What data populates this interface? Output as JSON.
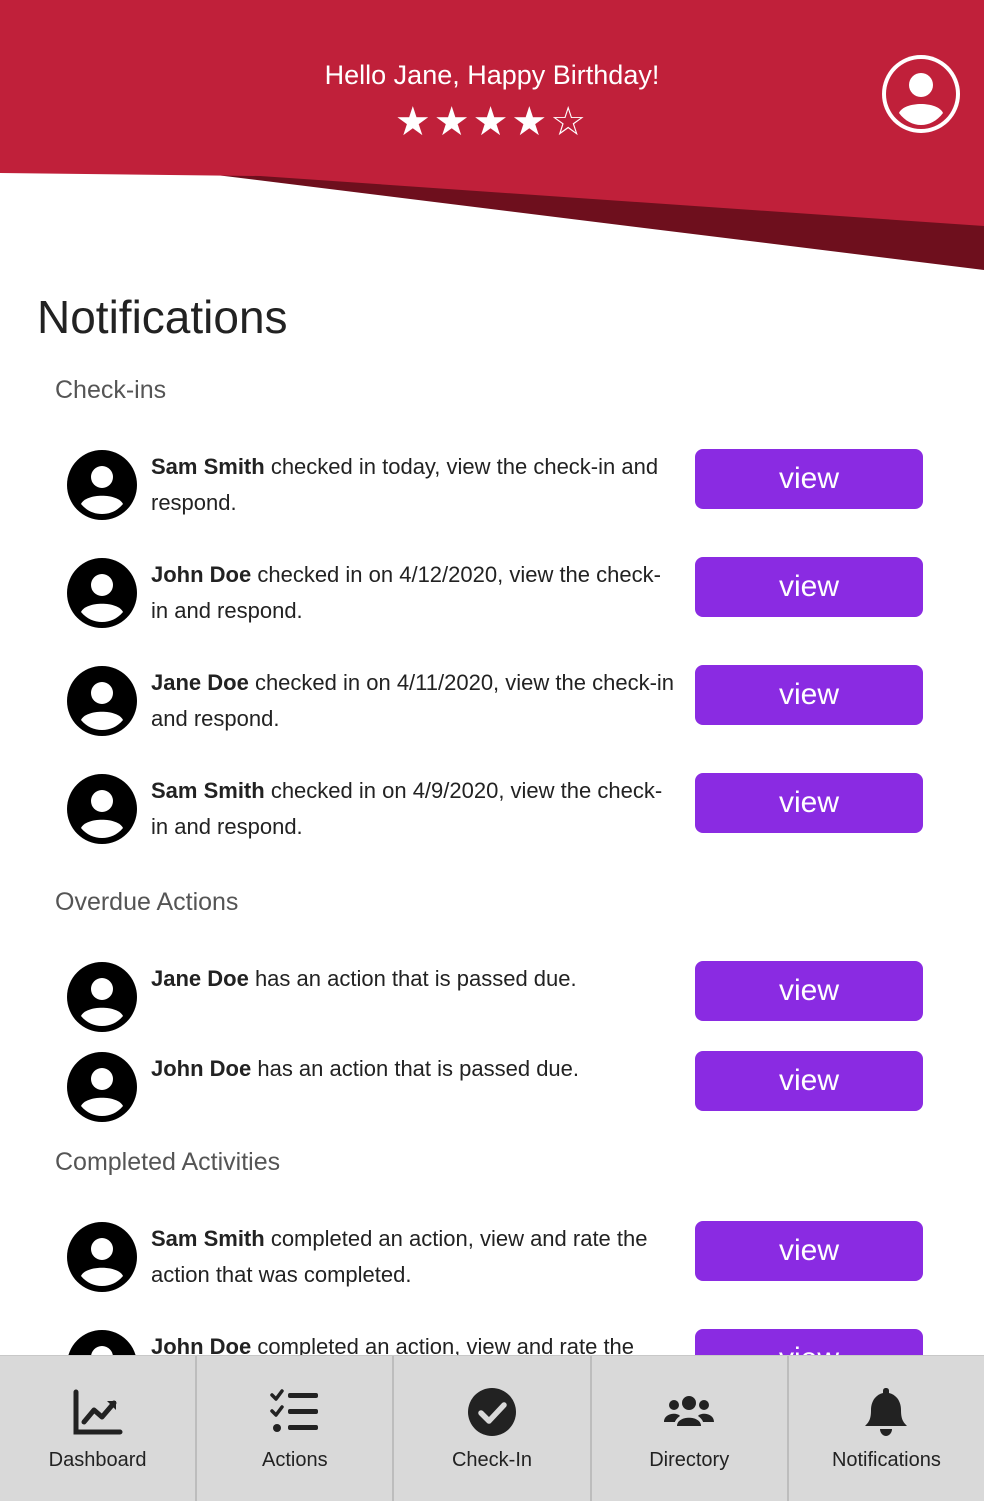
{
  "header": {
    "greeting": "Hello Jane, Happy Birthday!",
    "stars_text": "★★★★☆",
    "rating": 4,
    "rating_max": 5,
    "profile_icon": "user-circle-icon"
  },
  "page_title": "Notifications",
  "sections": {
    "checkins": {
      "heading": "Check-ins",
      "items": [
        {
          "name": "Sam Smith",
          "text": " checked in today, view the check-in and respond.",
          "button": "view"
        },
        {
          "name": "John Doe",
          "text": " checked in on 4/12/2020, view the check-in and respond.",
          "button": "view"
        },
        {
          "name": "Jane Doe",
          "text": " checked in on 4/11/2020, view the check-in and respond.",
          "button": "view"
        },
        {
          "name": "Sam Smith",
          "text": " checked in on 4/9/2020, view the check-in and respond.",
          "button": "view"
        }
      ]
    },
    "overdue": {
      "heading": "Overdue Actions",
      "items": [
        {
          "name": "Jane Doe",
          "text": " has an action that is passed due.",
          "button": "view"
        },
        {
          "name": "John Doe",
          "text": " has an action that is passed due.",
          "button": "view"
        }
      ]
    },
    "completed": {
      "heading": "Completed Activities",
      "items": [
        {
          "name": "Sam Smith",
          "text": " completed an action, view and rate the action that was completed.",
          "button": "view"
        },
        {
          "name": "John Doe",
          "text": " completed an action, view and rate the action that was completed.",
          "button": "view"
        }
      ]
    }
  },
  "nav": {
    "items": [
      {
        "label": "Dashboard",
        "icon": "chart-line-icon"
      },
      {
        "label": "Actions",
        "icon": "tasks-icon"
      },
      {
        "label": "Check-In",
        "icon": "check-circle-icon"
      },
      {
        "label": "Directory",
        "icon": "users-icon"
      },
      {
        "label": "Notifications",
        "icon": "bell-icon"
      }
    ]
  },
  "colors": {
    "header_red": "#c0203a",
    "header_dark_red": "#6e0f1d",
    "button_purple": "#8a2be2",
    "nav_bg": "#d9d9d9"
  }
}
